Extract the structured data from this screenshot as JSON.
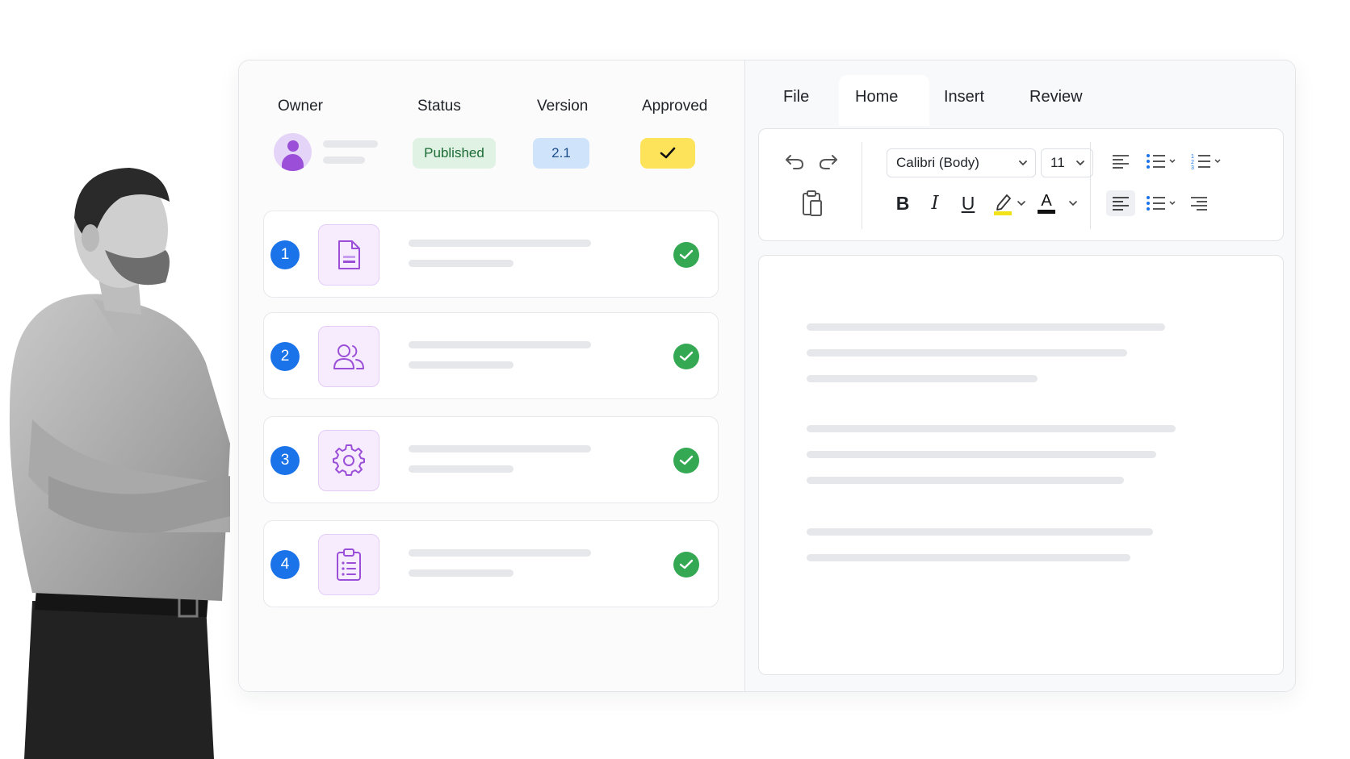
{
  "table_header": {
    "owner": "Owner",
    "status": "Status",
    "version": "Version",
    "approved": "Approved"
  },
  "status_badge": "Published",
  "version_badge": "2.1",
  "steps": [
    {
      "number": "1",
      "icon": "document-icon",
      "done": true
    },
    {
      "number": "2",
      "icon": "users-icon",
      "done": true
    },
    {
      "number": "3",
      "icon": "gear-icon",
      "done": true
    },
    {
      "number": "4",
      "icon": "clipboard-list-icon",
      "done": true
    }
  ],
  "menu": {
    "file": "File",
    "home": "Home",
    "insert": "Insert",
    "review": "Review",
    "active": "Home"
  },
  "toolbar": {
    "font_family": "Calibri (Body)",
    "font_size": "11",
    "bold": "B",
    "italic": "I",
    "underline": "U",
    "font_color_letter": "A",
    "highlight_color": "#f2e21a",
    "font_color": "#111111"
  },
  "colors": {
    "accent_blue": "#1a73e8",
    "success_green": "#34a853",
    "approved_yellow": "#fde35a",
    "icon_purple": "#9b4fd8"
  }
}
